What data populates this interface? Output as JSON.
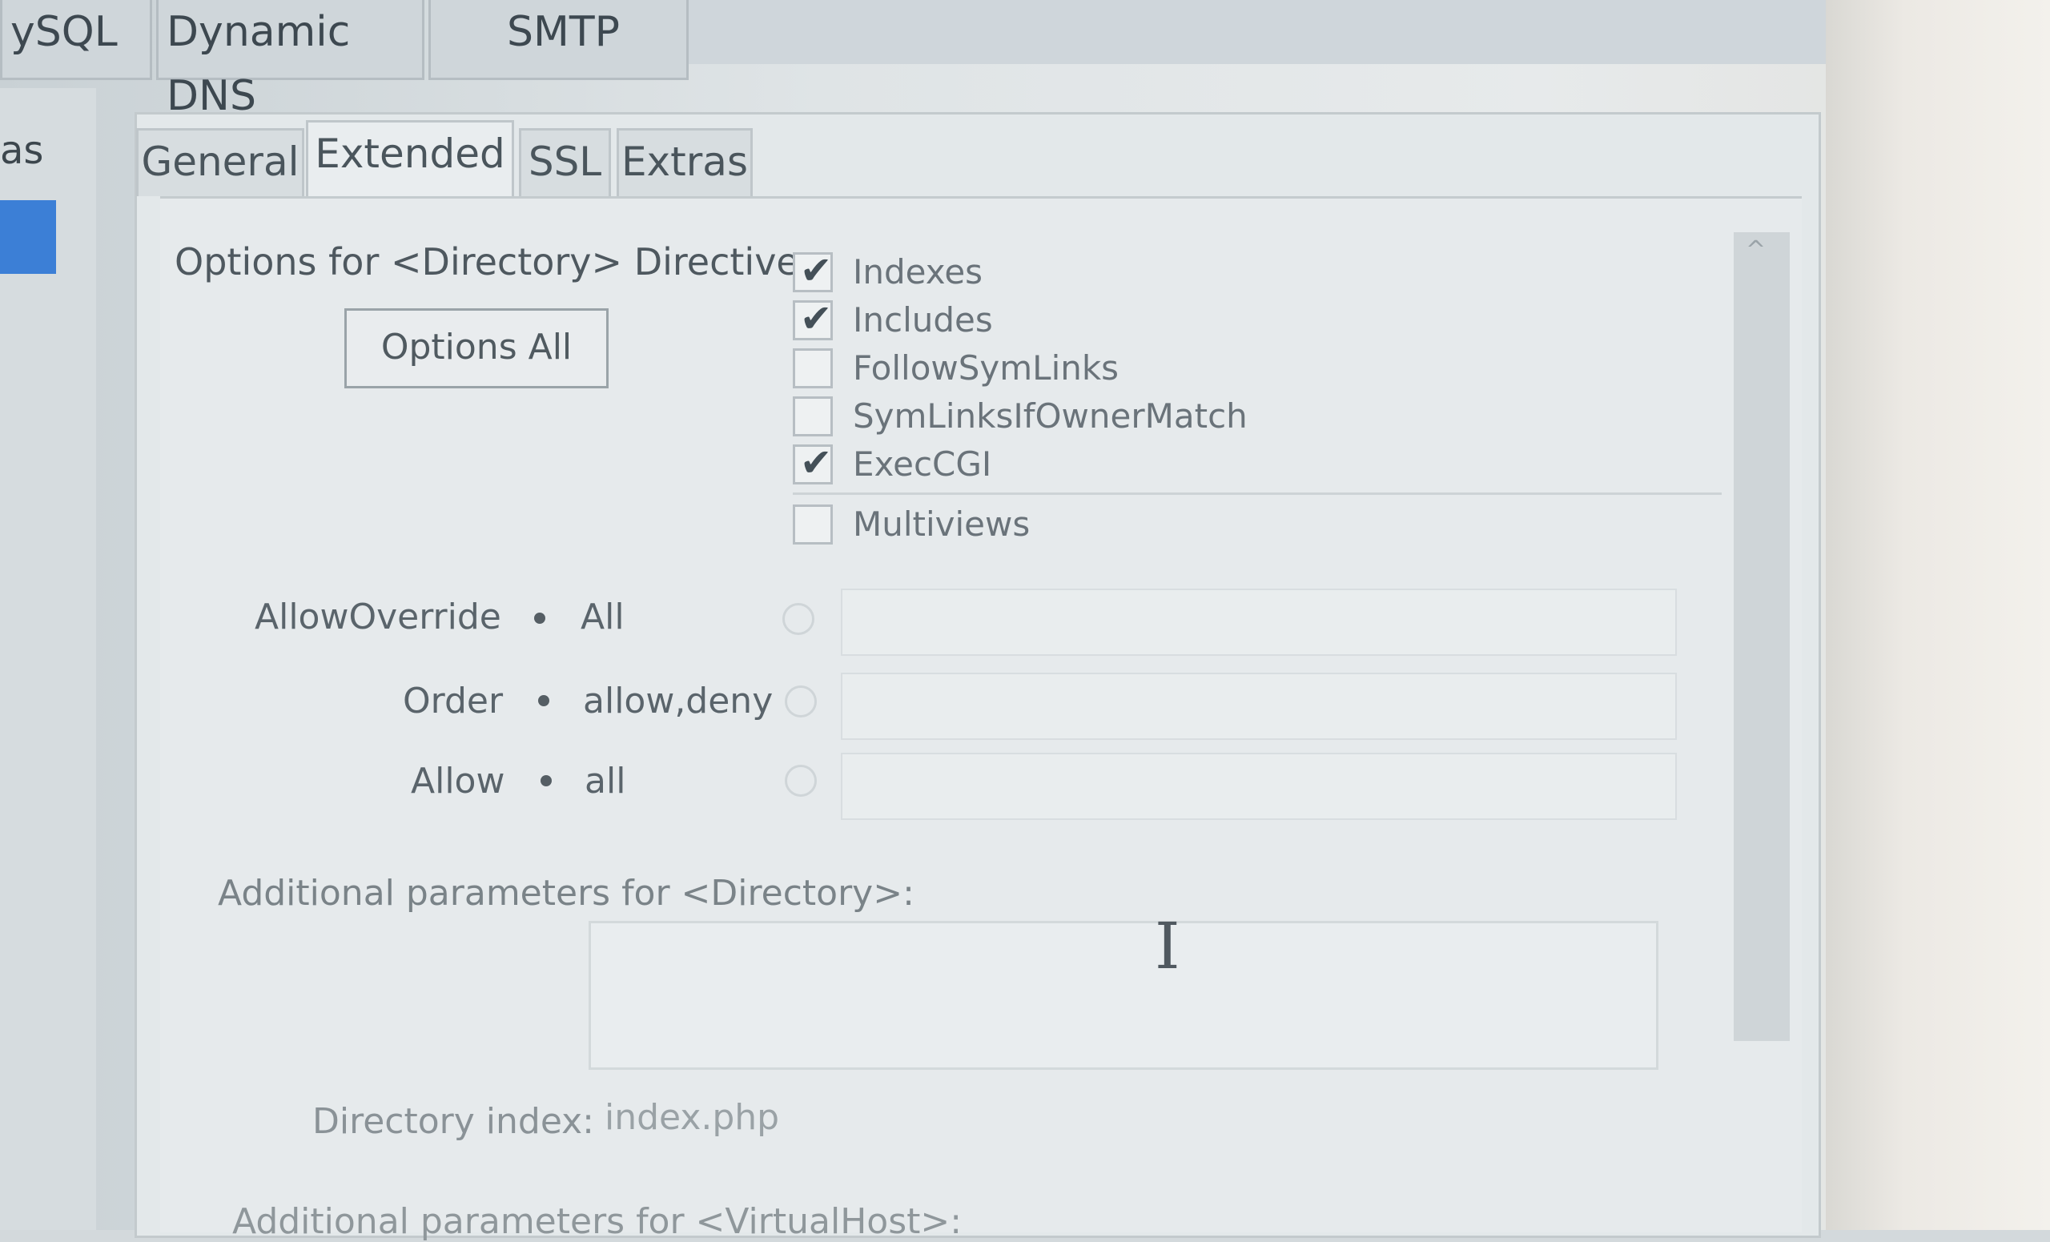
{
  "top_tabs": [
    "ySQL",
    "Dynamic DNS",
    "SMTP"
  ],
  "left_sidebar": {
    "label": "as"
  },
  "sub_tabs": [
    "General",
    "Extended",
    "SSL",
    "Extras"
  ],
  "active_sub_tab": "Extended",
  "directory_options": {
    "label": "Options for <Directory> Directive:",
    "button": "Options All",
    "options": [
      {
        "label": "Indexes",
        "checked": true
      },
      {
        "label": "Includes",
        "checked": true
      },
      {
        "label": "FollowSymLinks",
        "checked": false
      },
      {
        "label": "SymLinksIfOwnerMatch",
        "checked": false
      },
      {
        "label": "ExecCGI",
        "checked": true
      },
      {
        "label": "Multiviews",
        "checked": false
      }
    ]
  },
  "radio_settings": {
    "allow_override": {
      "label": "AllowOverride",
      "value": "All"
    },
    "order": {
      "label": "Order",
      "value": "allow,deny"
    },
    "allow": {
      "label": "Allow",
      "value": "all"
    }
  },
  "additional_directory": {
    "label": "Additional parameters for <Directory>:"
  },
  "directory_index": {
    "label": "Directory index:",
    "value": "index.php"
  },
  "additional_virtualhost": {
    "label": "Additional parameters for <VirtualHost>:"
  },
  "check_mark": "✔",
  "icons": {
    "text-cursor": "I",
    "scroll-up": "^"
  }
}
